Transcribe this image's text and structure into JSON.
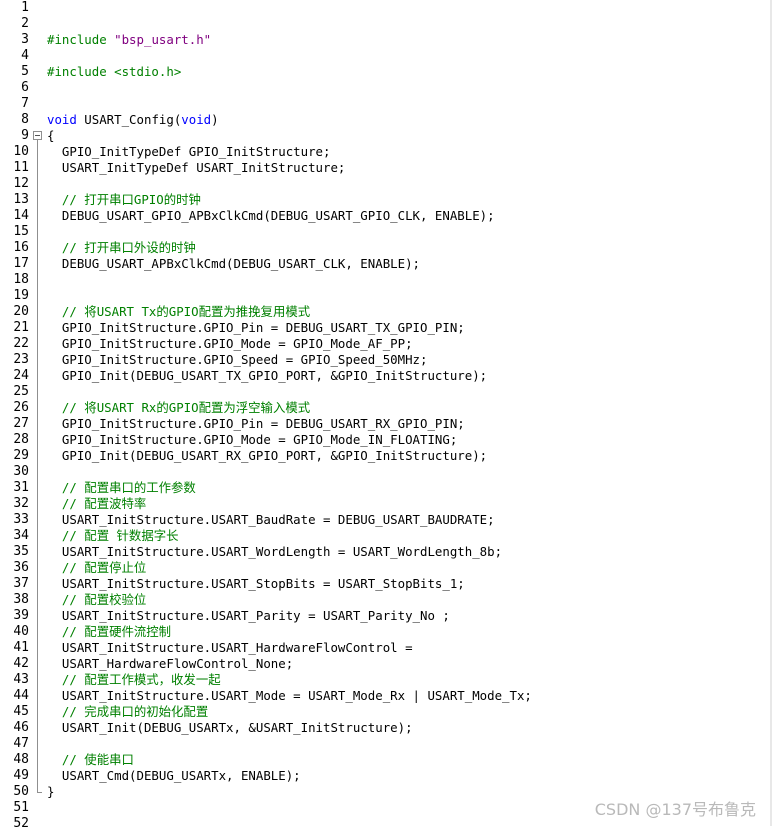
{
  "colors": {
    "preprocessor": "#008000",
    "keyword": "#0000ff",
    "string": "#800080",
    "comment": "#008000",
    "plain": "#000000"
  },
  "watermark": "CSDN @137号布鲁克",
  "lines": [
    {
      "n": "1",
      "segs": []
    },
    {
      "n": "2",
      "segs": []
    },
    {
      "n": "3",
      "segs": [
        {
          "t": "pp",
          "v": "#include "
        },
        {
          "t": "str",
          "v": "\"bsp_usart.h\""
        }
      ]
    },
    {
      "n": "4",
      "segs": []
    },
    {
      "n": "5",
      "segs": [
        {
          "t": "pp",
          "v": "#include <stdio.h>"
        }
      ]
    },
    {
      "n": "6",
      "segs": []
    },
    {
      "n": "7",
      "segs": []
    },
    {
      "n": "8",
      "segs": [
        {
          "t": "kw",
          "v": "void"
        },
        {
          "t": "plain",
          "v": " USART_Config("
        },
        {
          "t": "kw",
          "v": "void"
        },
        {
          "t": "plain",
          "v": ")"
        }
      ]
    },
    {
      "n": "9",
      "segs": [
        {
          "t": "plain",
          "v": "{"
        }
      ]
    },
    {
      "n": "10",
      "segs": [
        {
          "t": "plain",
          "v": "  GPIO_InitTypeDef GPIO_InitStructure;"
        }
      ]
    },
    {
      "n": "11",
      "segs": [
        {
          "t": "plain",
          "v": "  USART_InitTypeDef USART_InitStructure;"
        }
      ]
    },
    {
      "n": "12",
      "segs": []
    },
    {
      "n": "13",
      "segs": [
        {
          "t": "com",
          "v": "  // 打开串口GPIO的时钟"
        }
      ]
    },
    {
      "n": "14",
      "segs": [
        {
          "t": "plain",
          "v": "  DEBUG_USART_GPIO_APBxClkCmd(DEBUG_USART_GPIO_CLK, ENABLE);"
        }
      ]
    },
    {
      "n": "15",
      "segs": []
    },
    {
      "n": "16",
      "segs": [
        {
          "t": "com",
          "v": "  // 打开串口外设的时钟"
        }
      ]
    },
    {
      "n": "17",
      "segs": [
        {
          "t": "plain",
          "v": "  DEBUG_USART_APBxClkCmd(DEBUG_USART_CLK, ENABLE);"
        }
      ]
    },
    {
      "n": "18",
      "segs": []
    },
    {
      "n": "19",
      "segs": []
    },
    {
      "n": "20",
      "segs": [
        {
          "t": "com",
          "v": "  // 将USART Tx的GPIO配置为推挽复用模式"
        }
      ]
    },
    {
      "n": "21",
      "segs": [
        {
          "t": "plain",
          "v": "  GPIO_InitStructure.GPIO_Pin = DEBUG_USART_TX_GPIO_PIN;"
        }
      ]
    },
    {
      "n": "22",
      "segs": [
        {
          "t": "plain",
          "v": "  GPIO_InitStructure.GPIO_Mode = GPIO_Mode_AF_PP;"
        }
      ]
    },
    {
      "n": "23",
      "segs": [
        {
          "t": "plain",
          "v": "  GPIO_InitStructure.GPIO_Speed = GPIO_Speed_50MHz;"
        }
      ]
    },
    {
      "n": "24",
      "segs": [
        {
          "t": "plain",
          "v": "  GPIO_Init(DEBUG_USART_TX_GPIO_PORT, &GPIO_InitStructure);"
        }
      ]
    },
    {
      "n": "25",
      "segs": []
    },
    {
      "n": "26",
      "segs": [
        {
          "t": "com",
          "v": "  // 将USART Rx的GPIO配置为浮空输入模式"
        }
      ]
    },
    {
      "n": "27",
      "segs": [
        {
          "t": "plain",
          "v": "  GPIO_InitStructure.GPIO_Pin = DEBUG_USART_RX_GPIO_PIN;"
        }
      ]
    },
    {
      "n": "28",
      "segs": [
        {
          "t": "plain",
          "v": "  GPIO_InitStructure.GPIO_Mode = GPIO_Mode_IN_FLOATING;"
        }
      ]
    },
    {
      "n": "29",
      "segs": [
        {
          "t": "plain",
          "v": "  GPIO_Init(DEBUG_USART_RX_GPIO_PORT, &GPIO_InitStructure);"
        }
      ]
    },
    {
      "n": "30",
      "segs": []
    },
    {
      "n": "31",
      "segs": [
        {
          "t": "com",
          "v": "  // 配置串口的工作参数"
        }
      ]
    },
    {
      "n": "32",
      "segs": [
        {
          "t": "com",
          "v": "  // 配置波特率"
        }
      ]
    },
    {
      "n": "33",
      "segs": [
        {
          "t": "plain",
          "v": "  USART_InitStructure.USART_BaudRate = DEBUG_USART_BAUDRATE;"
        }
      ]
    },
    {
      "n": "34",
      "segs": [
        {
          "t": "com",
          "v": "  // 配置 针数据字长"
        }
      ]
    },
    {
      "n": "35",
      "segs": [
        {
          "t": "plain",
          "v": "  USART_InitStructure.USART_WordLength = USART_WordLength_8b;"
        }
      ]
    },
    {
      "n": "36",
      "segs": [
        {
          "t": "com",
          "v": "  // 配置停止位"
        }
      ]
    },
    {
      "n": "37",
      "segs": [
        {
          "t": "plain",
          "v": "  USART_InitStructure.USART_StopBits = USART_StopBits_1;"
        }
      ]
    },
    {
      "n": "38",
      "segs": [
        {
          "t": "com",
          "v": "  // 配置校验位"
        }
      ]
    },
    {
      "n": "39",
      "segs": [
        {
          "t": "plain",
          "v": "  USART_InitStructure.USART_Parity = USART_Parity_No ;"
        }
      ]
    },
    {
      "n": "40",
      "segs": [
        {
          "t": "com",
          "v": "  // 配置硬件流控制"
        }
      ]
    },
    {
      "n": "41",
      "segs": [
        {
          "t": "plain",
          "v": "  USART_InitStructure.USART_HardwareFlowControl ="
        }
      ]
    },
    {
      "n": "42",
      "segs": [
        {
          "t": "plain",
          "v": "  USART_HardwareFlowControl_None;"
        }
      ]
    },
    {
      "n": "43",
      "segs": [
        {
          "t": "com",
          "v": "  // 配置工作模式，收发一起"
        }
      ]
    },
    {
      "n": "44",
      "segs": [
        {
          "t": "plain",
          "v": "  USART_InitStructure.USART_Mode = USART_Mode_Rx | USART_Mode_Tx;"
        }
      ]
    },
    {
      "n": "45",
      "segs": [
        {
          "t": "com",
          "v": "  // 完成串口的初始化配置"
        }
      ]
    },
    {
      "n": "46",
      "segs": [
        {
          "t": "plain",
          "v": "  USART_Init(DEBUG_USARTx, &USART_InitStructure);"
        }
      ]
    },
    {
      "n": "47",
      "segs": []
    },
    {
      "n": "48",
      "segs": [
        {
          "t": "com",
          "v": "  // 使能串口"
        }
      ]
    },
    {
      "n": "49",
      "segs": [
        {
          "t": "plain",
          "v": "  USART_Cmd(DEBUG_USARTx, ENABLE);"
        }
      ]
    },
    {
      "n": "50",
      "segs": [
        {
          "t": "plain",
          "v": "}"
        }
      ]
    },
    {
      "n": "51",
      "segs": []
    },
    {
      "n": "52",
      "segs": []
    }
  ]
}
